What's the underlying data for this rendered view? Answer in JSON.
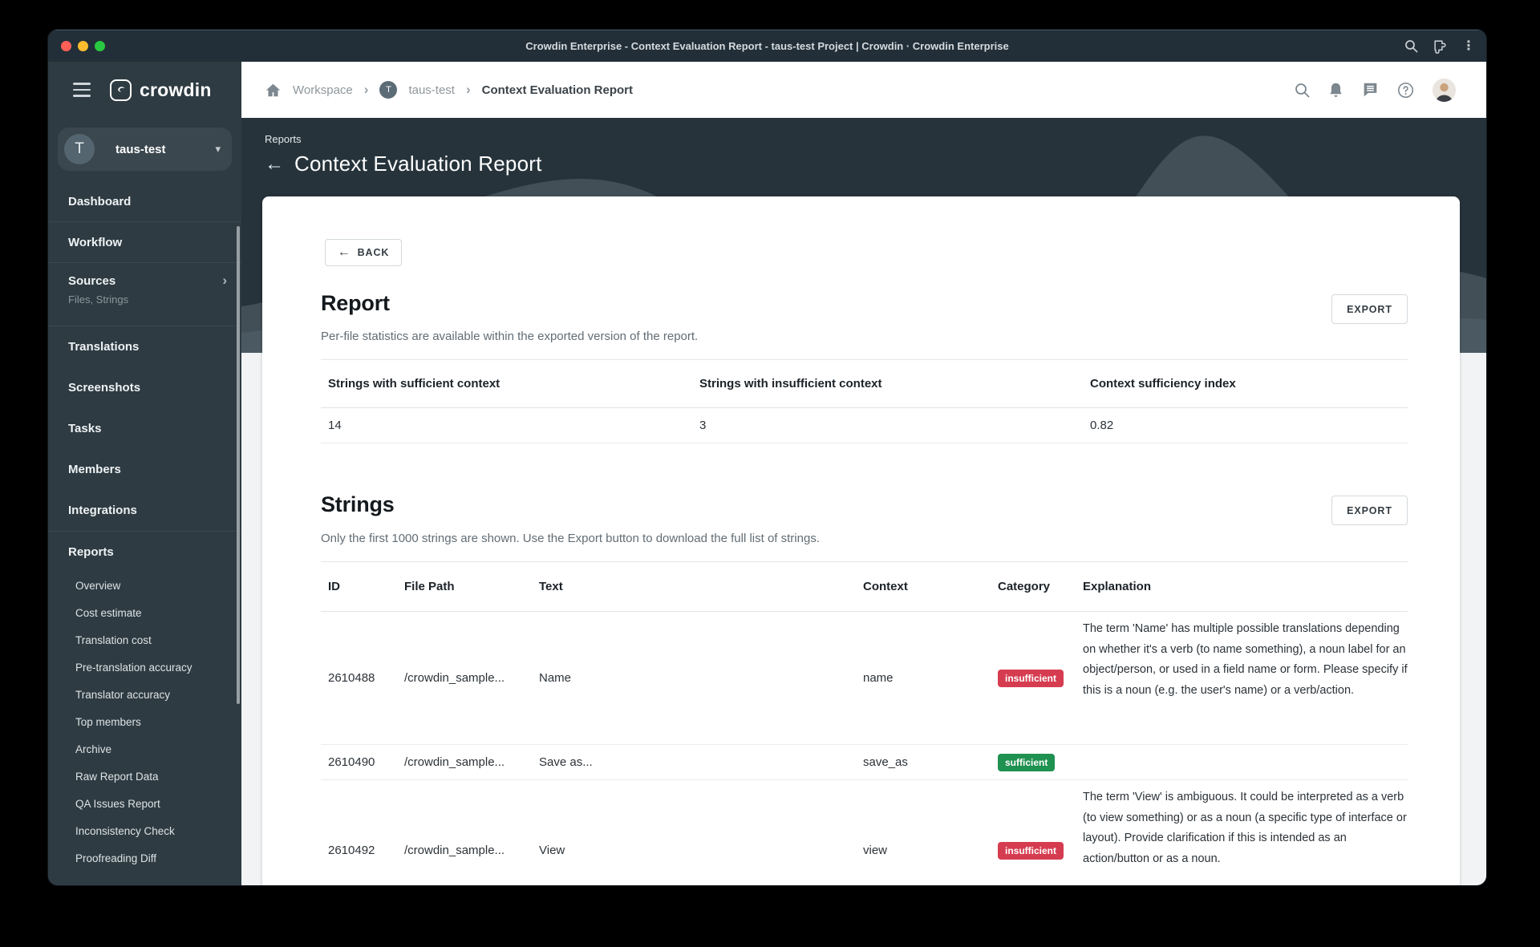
{
  "titlebar": {
    "title": "Crowdin Enterprise - Context Evaluation Report - taus-test Project | Crowdin · Crowdin Enterprise"
  },
  "icons": {
    "back_arrow": "←",
    "chevron_right": "›",
    "caret_down": "▾",
    "overflow_menu": "⋮",
    "logo_glyph": "C"
  },
  "breadcrumb": {
    "workspace": "Workspace",
    "project_initial": "T",
    "project": "taus-test",
    "current": "Context Evaluation Report"
  },
  "sidebar": {
    "logo_text": "crowdin",
    "project_selector": {
      "initial": "T",
      "name": "taus-test"
    },
    "items": [
      {
        "label": "Dashboard"
      },
      {
        "label": "Workflow"
      },
      {
        "label": "Sources",
        "subtitle": "Files, Strings"
      },
      {
        "label": "Translations"
      },
      {
        "label": "Screenshots"
      },
      {
        "label": "Tasks"
      },
      {
        "label": "Members"
      },
      {
        "label": "Integrations"
      },
      {
        "label": "Reports"
      }
    ],
    "report_items": [
      {
        "label": "Overview"
      },
      {
        "label": "Cost estimate"
      },
      {
        "label": "Translation cost"
      },
      {
        "label": "Pre-translation accuracy"
      },
      {
        "label": "Translator accuracy"
      },
      {
        "label": "Top members"
      },
      {
        "label": "Archive"
      },
      {
        "label": "Raw Report Data"
      },
      {
        "label": "QA Issues Report"
      },
      {
        "label": "Inconsistency Check"
      },
      {
        "label": "Proofreading Diff"
      }
    ]
  },
  "hero": {
    "eyebrow": "Reports",
    "title": "Context Evaluation Report"
  },
  "report_section": {
    "back_label": "BACK",
    "title": "Report",
    "subtitle": "Per-file statistics are available within the exported version of the report.",
    "export_label": "EXPORT",
    "stats": {
      "headers": [
        "Strings with sufficient context",
        "Strings with insufficient context",
        "Context sufficiency index"
      ],
      "values": [
        "14",
        "3",
        "0.82"
      ]
    }
  },
  "strings_section": {
    "title": "Strings",
    "subtitle": "Only the first 1000 strings are shown. Use the Export button to download the full list of strings.",
    "export_label": "EXPORT",
    "table": {
      "headers": [
        "ID",
        "File Path",
        "Text",
        "Context",
        "Category",
        "Explanation"
      ],
      "rows": [
        {
          "id": "2610488",
          "file_path": "/crowdin_sample...",
          "text": "Name",
          "context": "name",
          "category": "insufficient",
          "explanation": "The term 'Name' has multiple possible translations depending on whether it's a verb (to name something), a noun label for an object/person, or used in a field name or form. Please specify if this is a noun (e.g. the user's name) or a verb/action."
        },
        {
          "id": "2610490",
          "file_path": "/crowdin_sample...",
          "text": "Save as...",
          "context": "save_as",
          "category": "sufficient",
          "explanation": ""
        },
        {
          "id": "2610492",
          "file_path": "/crowdin_sample...",
          "text": "View",
          "context": "view",
          "category": "insufficient",
          "explanation": "The term 'View' is ambiguous. It could be interpreted as a verb (to view something) or as a noun (a specific type of interface or layout). Provide clarification if this is intended as an action/button or as a noun."
        }
      ]
    }
  },
  "colors": {
    "titlebar_bg": "#232f38",
    "sidebar_bg": "#2e3b42",
    "hero_bg": "#26333b",
    "badge_insufficient": "#d63c50",
    "badge_sufficient": "#1f9150"
  }
}
